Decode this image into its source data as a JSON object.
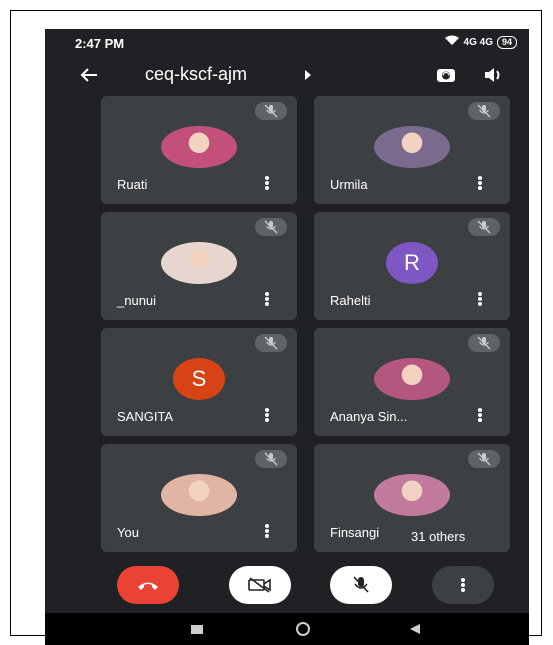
{
  "status": {
    "time": "2:47 PM",
    "signal": "4G 4G",
    "battery": "94"
  },
  "meeting": {
    "code": "ceq-kscf-ajm"
  },
  "participants": [
    {
      "name": "Ruati",
      "type": "photo",
      "color": "#c2507a"
    },
    {
      "name": "Urmila",
      "type": "photo",
      "color": "#7b6b8e"
    },
    {
      "name": "_nunui",
      "type": "photo",
      "color": "#e7d6cf"
    },
    {
      "name": "Rahelti",
      "type": "letter",
      "letter": "R",
      "color": "#7e57c2"
    },
    {
      "name": "SANGITA",
      "type": "letter",
      "letter": "S",
      "color": "#d84315"
    },
    {
      "name": "Ananya Sin...",
      "type": "photo",
      "color": "#b4577e"
    },
    {
      "name": "You",
      "type": "photo",
      "color": "#e0b5a5"
    },
    {
      "name": "Finsangi",
      "type": "photo",
      "color": "#c27b9e"
    }
  ],
  "others_label": "31 others",
  "colors": {
    "end_call": "#ea4335",
    "tile": "#3c4043",
    "background": "#202124"
  }
}
